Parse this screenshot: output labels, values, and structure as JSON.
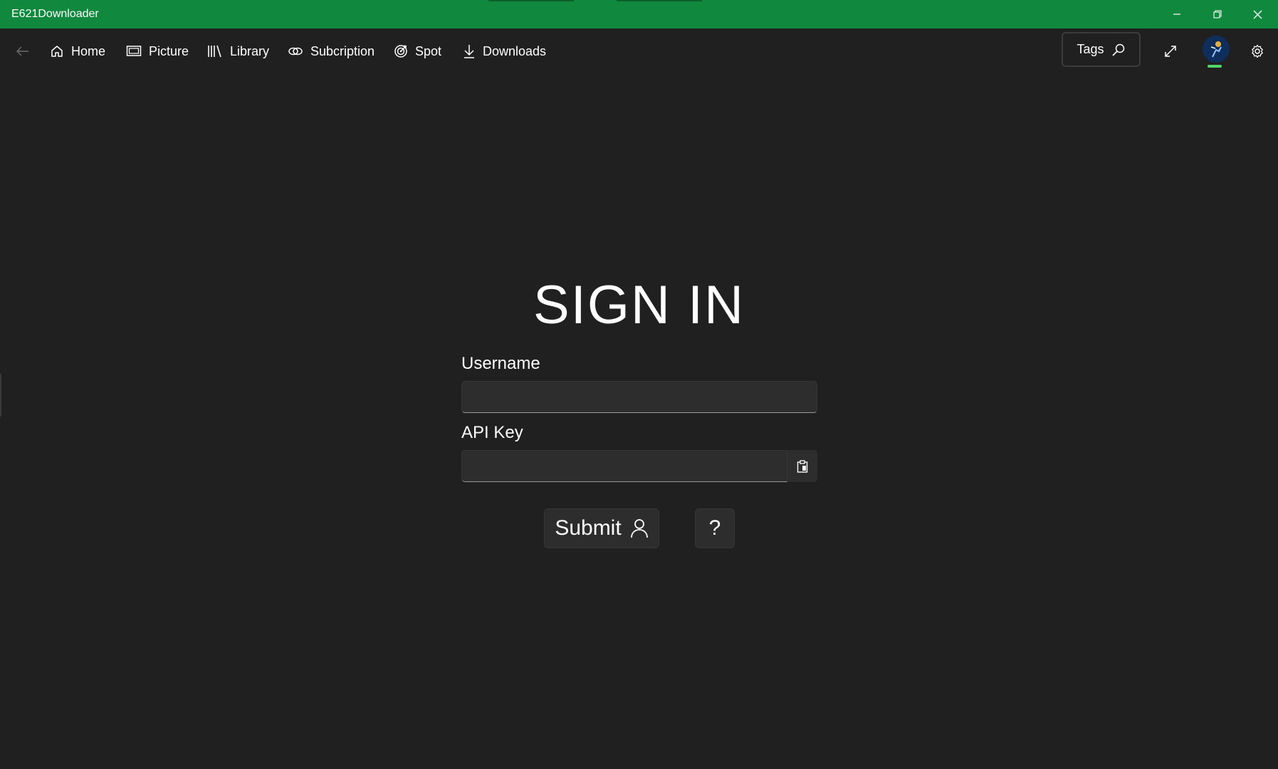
{
  "window": {
    "title": "E621Downloader",
    "accent_color": "#10893e",
    "background_color": "#202020"
  },
  "titlebar_buttons": [
    {
      "name": "minimize-icon"
    },
    {
      "name": "restore-icon"
    },
    {
      "name": "close-icon"
    }
  ],
  "nav": {
    "back_icon": "back-arrow-icon",
    "items": [
      {
        "label": "Home",
        "icon": "home-icon"
      },
      {
        "label": "Picture",
        "icon": "picture-icon"
      },
      {
        "label": "Library",
        "icon": "library-icon"
      },
      {
        "label": "Subcription",
        "icon": "link-icon"
      },
      {
        "label": "Spot",
        "icon": "target-icon"
      },
      {
        "label": "Downloads",
        "icon": "download-icon"
      }
    ],
    "tags_label": "Tags",
    "tags_icon": "search-icon",
    "fullscreen_icon": "expand-icon",
    "avatar_icon": "user-avatar",
    "settings_icon": "gear-icon"
  },
  "signin": {
    "heading": "SIGN IN",
    "username_label": "Username",
    "username_value": "",
    "api_key_label": "API Key",
    "api_key_value": "",
    "paste_icon": "clipboard-icon",
    "submit_label": "Submit",
    "submit_icon": "person-icon",
    "help_label": "?"
  }
}
